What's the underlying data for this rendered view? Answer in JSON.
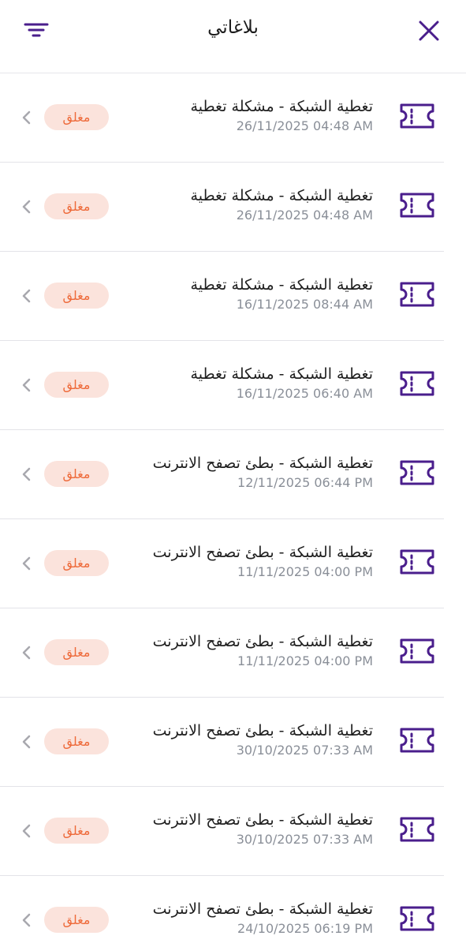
{
  "header": {
    "title": "بلاغاتي",
    "close_icon": "close-icon",
    "filter_icon": "filter-icon"
  },
  "colors": {
    "accent": "#4a1e8c",
    "badge_bg": "#fbe3dc",
    "badge_text": "#ee6a3a"
  },
  "tickets": [
    {
      "title": "تغطية الشبكة - مشكلة تغطية",
      "date": "26/11/2025 04:48 AM",
      "status": "مغلق"
    },
    {
      "title": "تغطية الشبكة - مشكلة تغطية",
      "date": "26/11/2025 04:48 AM",
      "status": "مغلق"
    },
    {
      "title": "تغطية الشبكة - مشكلة تغطية",
      "date": "16/11/2025 08:44 AM",
      "status": "مغلق"
    },
    {
      "title": "تغطية الشبكة - مشكلة تغطية",
      "date": "16/11/2025 06:40 AM",
      "status": "مغلق"
    },
    {
      "title": "تغطية الشبكة - بطئ تصفح الانترنت",
      "date": "12/11/2025 06:44 PM",
      "status": "مغلق"
    },
    {
      "title": "تغطية الشبكة - بطئ تصفح الانترنت",
      "date": "11/11/2025 04:00 PM",
      "status": "مغلق"
    },
    {
      "title": "تغطية الشبكة - بطئ تصفح الانترنت",
      "date": "11/11/2025 04:00 PM",
      "status": "مغلق"
    },
    {
      "title": "تغطية الشبكة - بطئ تصفح الانترنت",
      "date": "30/10/2025 07:33 AM",
      "status": "مغلق"
    },
    {
      "title": "تغطية الشبكة - بطئ تصفح الانترنت",
      "date": "30/10/2025 07:33 AM",
      "status": "مغلق"
    },
    {
      "title": "تغطية الشبكة - بطئ تصفح الانترنت",
      "date": "24/10/2025 06:19 PM",
      "status": "مغلق"
    }
  ]
}
